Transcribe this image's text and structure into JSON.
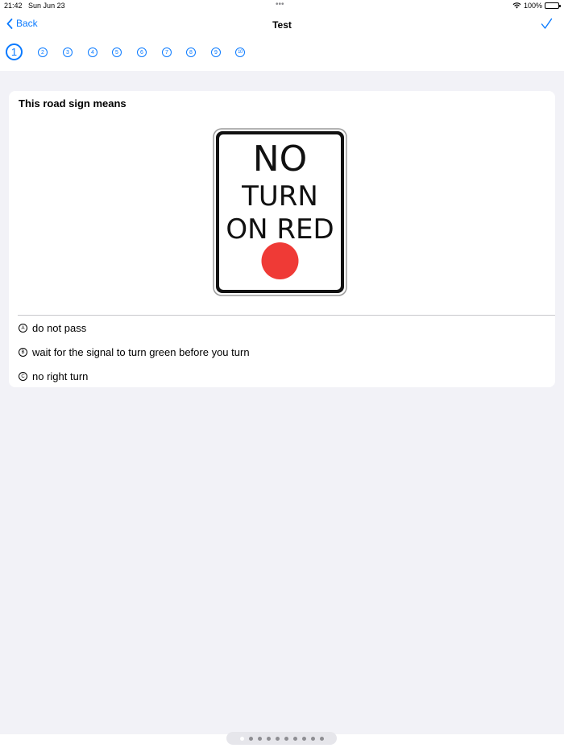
{
  "status_bar": {
    "time": "21:42",
    "date": "Sun Jun 23",
    "battery": "100%"
  },
  "navbar": {
    "back_label": "Back",
    "title": "Test"
  },
  "question_numbers": [
    "1",
    "2",
    "3",
    "4",
    "5",
    "6",
    "7",
    "8",
    "9",
    "10"
  ],
  "current_question": 1,
  "question": {
    "text": "This road sign means",
    "sign": {
      "line1": "NO",
      "line2": "TURN",
      "line3": "ON RED",
      "dot_color": "#ef3a36"
    },
    "answers": [
      {
        "letter": "A",
        "text": "do not pass"
      },
      {
        "letter": "B",
        "text": "wait for the signal to turn green before you turn"
      },
      {
        "letter": "C",
        "text": "no right turn"
      }
    ]
  },
  "page_indicator": {
    "count": 10,
    "active": 1
  },
  "colors": {
    "accent": "#0a7aff",
    "background": "#f2f2f7",
    "card": "#ffffff"
  }
}
